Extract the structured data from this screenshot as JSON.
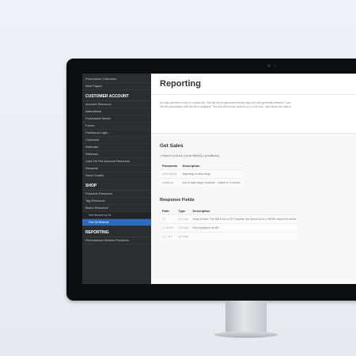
{
  "sidebar": {
    "top_items": [
      "Promotions Collection",
      "Web Pages"
    ],
    "section1_header": "CUSTOMER ACCOUNT",
    "section1_items": [
      "Account Resource",
      "Attendance",
      "Purchased Series",
      "Forms",
      "Facebook Login",
      "Contracts",
      "Referrals",
      "Referees",
      "Card On File Account Resource",
      "Rewards",
      "Store Credits"
    ],
    "section2_header": "SHOP",
    "section2_items": [
      "Products Resource",
      "Tag Resource",
      "Brand Resource"
    ],
    "section2_subitems": [
      "Get Brand by Id",
      "Get All Brands"
    ],
    "section3_header": "REPORTING",
    "section3_items": [
      "Performance Metrics Providers"
    ]
  },
  "main": {
    "title": "Reporting",
    "intro_line1": "As calls will return a link to a static file. This file will be generated shortly after the call (generally between 1 sec",
    "intro_line2": "the link periodically until the file is available. This link will remain valid for up to one hour, after which the data w",
    "get_sales": {
      "title": "Get Sales",
      "endpoint": "/report/sales/{startDate}/{endDate}",
      "param_header_parameter": "Parameter",
      "param_header_description": "Description",
      "params": [
        {
          "name": "startDate",
          "desc": "beginning of date range"
        },
        {
          "name": "endDate",
          "desc": "end of date range (inclusive - limited to 3 months"
        }
      ]
    },
    "response_fields": {
      "title": "Response Fields",
      "header_path": "Path",
      "header_type": "Type",
      "header_description": "Description",
      "rows": [
        {
          "path": "[]",
          "type": "string",
          "desc": "Array of links. The first is for a GET request, the second is for a HEAD request to check"
        },
        {
          "path": "[].href",
          "type": "string",
          "desc": "link to gzipped csv file"
        },
        {
          "path": "[].rel",
          "type": "string",
          "desc": ""
        }
      ]
    }
  }
}
